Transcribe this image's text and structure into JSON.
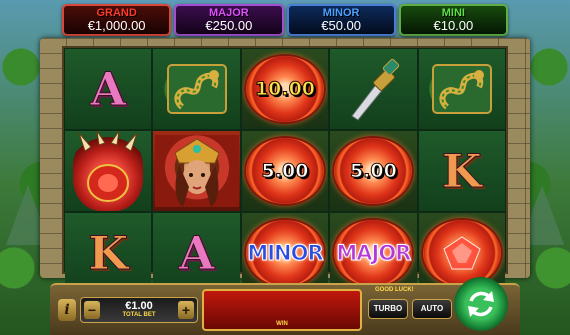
{
  "jackpots": [
    {
      "name": "GRAND",
      "value": "€1,000.00"
    },
    {
      "name": "MAJOR",
      "value": "€250.00"
    },
    {
      "name": "MINOR",
      "value": "€50.00"
    },
    {
      "name": "MINI",
      "value": "€10.00"
    }
  ],
  "reels": {
    "r1": {
      "top": "A",
      "bottom": "K"
    },
    "r2": {
      "bottom": "A"
    },
    "r3": {
      "coin_top": "10.00",
      "coin_mid": "5.00",
      "coin_bottom": "MINOR"
    },
    "r4": {
      "coin_mid": "5.00",
      "coin_bottom": "MAJOR"
    },
    "r5": {
      "mid": "K"
    }
  },
  "symbols": {
    "paw": "bear-paw-icon",
    "snake": "serpent-idol-icon",
    "dagger": "dagger-icon",
    "queen": "aztec-queen-icon",
    "gem": "red-gem-coin-icon"
  },
  "controls": {
    "info_label": "i",
    "minus_label": "−",
    "plus_label": "+",
    "bet_value": "€1.00",
    "bet_label": "TOTAL BET",
    "win_label": "WIN",
    "status_text": "GOOD LUCK!",
    "turbo_label": "TURBO",
    "auto_label": "AUTO"
  },
  "colors": {
    "grand": "#ff3a2a",
    "major": "#e24cff",
    "minor": "#4aa0ff",
    "mini": "#5ee04a",
    "spin": "#1a8a3a"
  }
}
